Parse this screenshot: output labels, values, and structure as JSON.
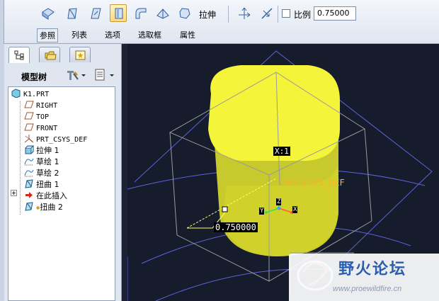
{
  "dashboard": {
    "feature_type_label": "拉伸",
    "ratio": {
      "label": "比例",
      "checked": false,
      "value": "0.75000"
    },
    "icons": [
      "toroidal-bend-icon",
      "spinal-bend-icon",
      "twist-icon",
      "warp-stretch-icon",
      "bend-icon",
      "sculpt-icon",
      "transform-icon"
    ],
    "active_icon_index": 3,
    "slideup_tabs": [
      "参照",
      "列表",
      "选项",
      "选取框",
      "属性"
    ],
    "active_slideup_index": 0
  },
  "navigator": {
    "tabs": [
      "model-tree-tab",
      "folder-browser-tab",
      "favorites-tab"
    ],
    "title": "模型树",
    "tree": [
      {
        "label": "K1.PRT",
        "icon": "part-icon",
        "indent": 0,
        "mono": true
      },
      {
        "label": "RIGHT",
        "icon": "datum-plane-icon",
        "indent": 1,
        "mono": true
      },
      {
        "label": "TOP",
        "icon": "datum-plane-icon",
        "indent": 1,
        "mono": true
      },
      {
        "label": "FRONT",
        "icon": "datum-plane-icon",
        "indent": 1,
        "mono": true
      },
      {
        "label": "PRT_CSYS_DEF",
        "icon": "csys-icon",
        "indent": 1,
        "mono": true
      },
      {
        "label": "拉伸 1",
        "icon": "extrude-icon",
        "indent": 1,
        "mono": false
      },
      {
        "label": "草绘 1",
        "icon": "sketch-icon",
        "indent": 1,
        "mono": false
      },
      {
        "label": "草绘 2",
        "icon": "sketch-icon",
        "indent": 1,
        "mono": false
      },
      {
        "label": "扭曲 1",
        "icon": "warp-icon",
        "indent": 1,
        "mono": false
      },
      {
        "label": "在此插入",
        "icon": "insert-here-arrow-icon",
        "indent": 1,
        "mono": false
      },
      {
        "label": "扭曲 2",
        "icon": "warp-icon",
        "indent": 1,
        "mono": false
      }
    ]
  },
  "graphics": {
    "dimension_value": "0.750000",
    "csys_label": "PRT_CSYS_DEF",
    "dim_tag": "X:1",
    "axes": {
      "x": "X",
      "y": "Y",
      "z": "Z"
    },
    "colors": {
      "background": "#161c2c",
      "model": "#f4f53a",
      "datum": "#5d63d8",
      "csys": "#ffb02e",
      "dimension": "#ffff66"
    }
  },
  "watermark": {
    "name": "野火论坛",
    "url": "www.proewildfire.cn"
  }
}
